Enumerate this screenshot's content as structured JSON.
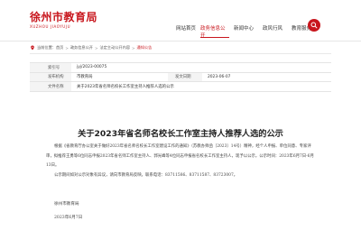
{
  "header": {
    "site_name": "徐州市教育局",
    "site_name_pinyin": "XUZHOU JIAOYUJU",
    "nav": [
      "网站首页",
      "政务信息公开",
      "新闻中心",
      "政风行风",
      "教育服务"
    ],
    "active_nav": 1,
    "accent_color": "#c8161d"
  },
  "breadcrumb": {
    "prefix": "当前位置：",
    "items": [
      "首页",
      "政务信息公开",
      "法定主动公开内容",
      "通知公告"
    ]
  },
  "meta": {
    "index_label": "索引号",
    "index_value": "jyj/2023-00075",
    "org_label": "发布机构",
    "org_value": "市教育局",
    "date_label": "发文日期",
    "date_value": "2023-06-07",
    "title_label": "文件名称",
    "title_value": "关于2023年省名师名校长工作室主持人推荐人选的公示"
  },
  "article": {
    "title": "关于2023年省名师名校长工作室主持人推荐人选的公示",
    "para1": "根据《省教育厅办公室关于做好2023年省名师名校长工作室建设工作的通知》（苏教办师函〔2023〕14号）精神，经个人申报、单位同意、专家评审，拟推荐王勇等6位同志申报2023年省名师工作室主持人、郭光峰等4位同志申报省名校长工作室主持人，现予以公示，公示时间：2023年6月7日-6月13日。",
    "para2": "公示期间如对公示对象有异议，请向市教育局反映。联系电话：83711586、83711587、83723007。",
    "signer": "徐州市教育局",
    "sign_date": "2023年6月7日"
  }
}
